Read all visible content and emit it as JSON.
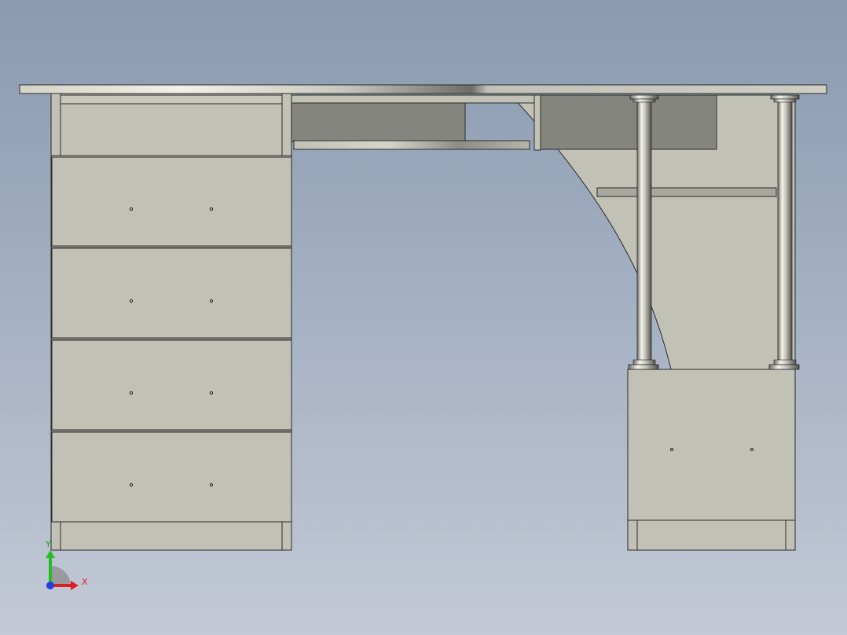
{
  "viewport": {
    "model": "desk-assembly",
    "view": "front"
  },
  "triad": {
    "x_label": "X",
    "y_label": "Y",
    "x_color": "#e02020",
    "y_color": "#20c020",
    "z_color": "#2040e0"
  },
  "colors": {
    "part_face": "#c2c1b6",
    "dark_panel": "#85857f",
    "edge": "#2a2a2a",
    "chrome": "#d8d8d0"
  },
  "parts": [
    "desktop",
    "left-pedestal",
    "drawer-1",
    "drawer-2",
    "drawer-3",
    "drawer-4",
    "keyboard-tray",
    "right-cabinet",
    "support-post-left",
    "support-post-right",
    "shelf",
    "curved-side-panel"
  ]
}
